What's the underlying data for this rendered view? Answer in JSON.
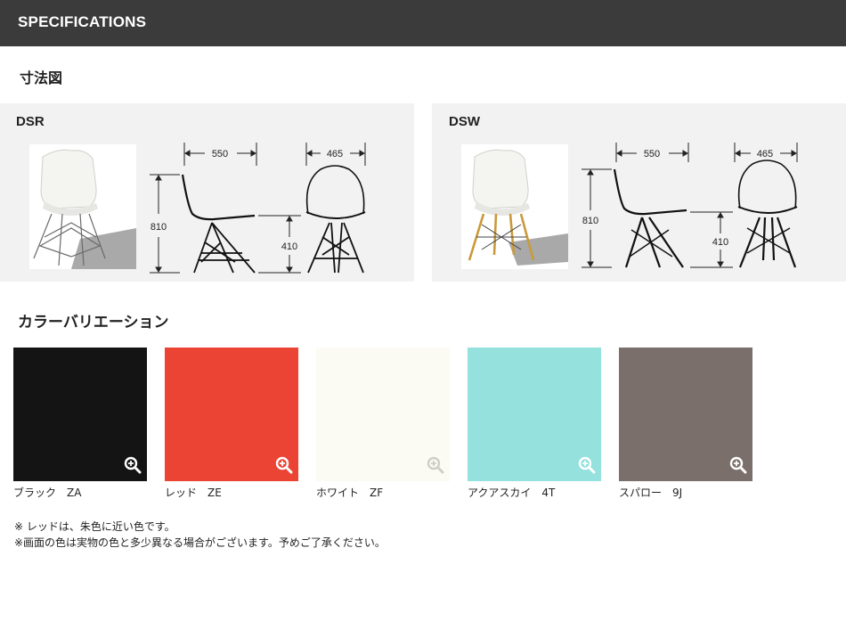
{
  "header": {
    "title": "SPECIFICATIONS"
  },
  "dimensions_section": {
    "title": "寸法図"
  },
  "panels": [
    {
      "label": "DSR",
      "width": "550",
      "depth": "465",
      "height": "810",
      "seat_height": "410",
      "base": "eiffel"
    },
    {
      "label": "DSW",
      "width": "550",
      "depth": "465",
      "height": "810",
      "seat_height": "410",
      "base": "dowel"
    }
  ],
  "color_section": {
    "title": "カラーバリエーション"
  },
  "colors": [
    {
      "label": "ブラック　ZA",
      "hex": "#141414",
      "icon": "zoom-icon"
    },
    {
      "label": "レッド　ZE",
      "hex": "#ec4434",
      "icon": "zoom-icon"
    },
    {
      "label": "ホワイト　ZF",
      "hex": "#fbfbf4",
      "icon": "zoom-icon"
    },
    {
      "label": "アクアスカイ　4T",
      "hex": "#94e1de",
      "icon": "zoom-icon"
    },
    {
      "label": "スパロー　9J",
      "hex": "#7a6f6a",
      "icon": "zoom-icon"
    }
  ],
  "notes": [
    "※ レッドは、朱色に近い色です。",
    "※画面の色は実物の色と多少異なる場合がございます。予めご了承ください。"
  ]
}
